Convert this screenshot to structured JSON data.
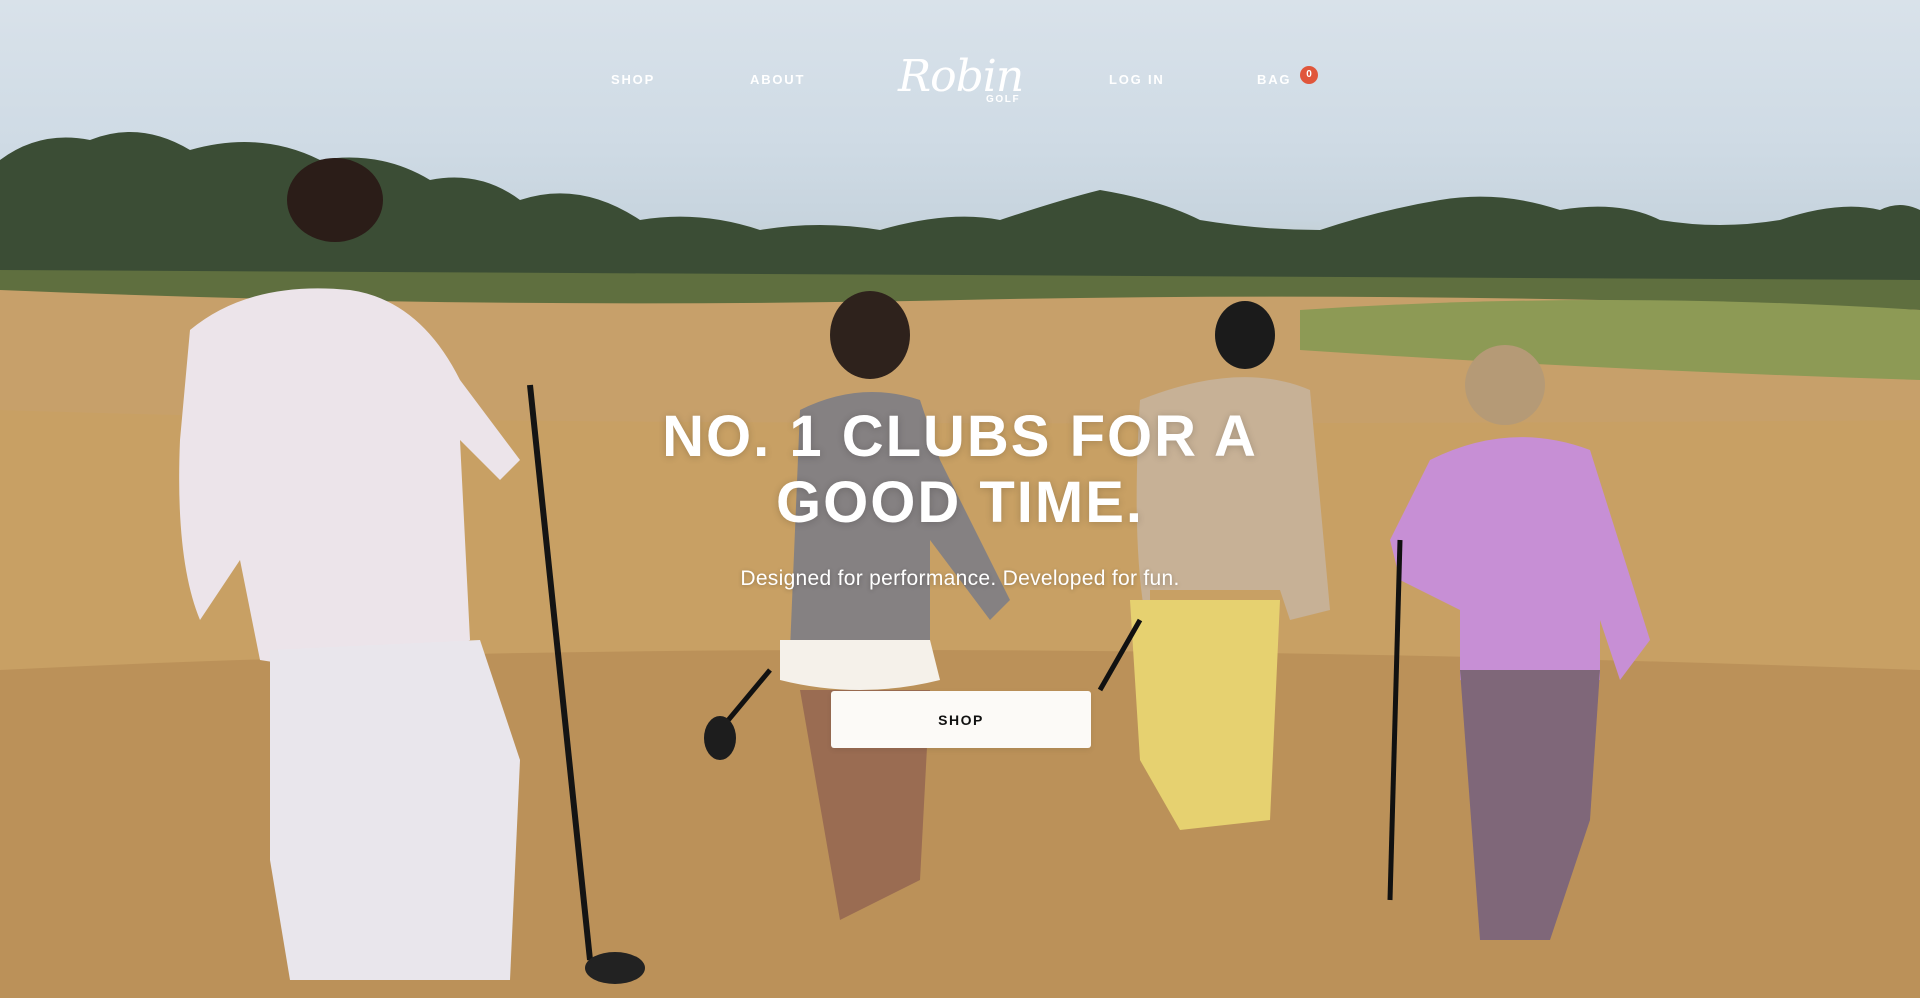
{
  "nav": {
    "shop": "SHOP",
    "about": "ABOUT",
    "login": "LOG IN",
    "bag": "BAG",
    "bag_count": "0"
  },
  "logo": {
    "script": "Robin",
    "sub": "GOLF"
  },
  "hero": {
    "headline_line1": "NO. 1 CLUBS FOR A",
    "headline_line2": "GOOD TIME.",
    "subheadline": "Designed for performance. Developed for fun.",
    "cta_label": "SHOP"
  },
  "colors": {
    "badge": "#e0563b",
    "cta_bg": "#fcfaf7",
    "text": "#ffffff"
  }
}
